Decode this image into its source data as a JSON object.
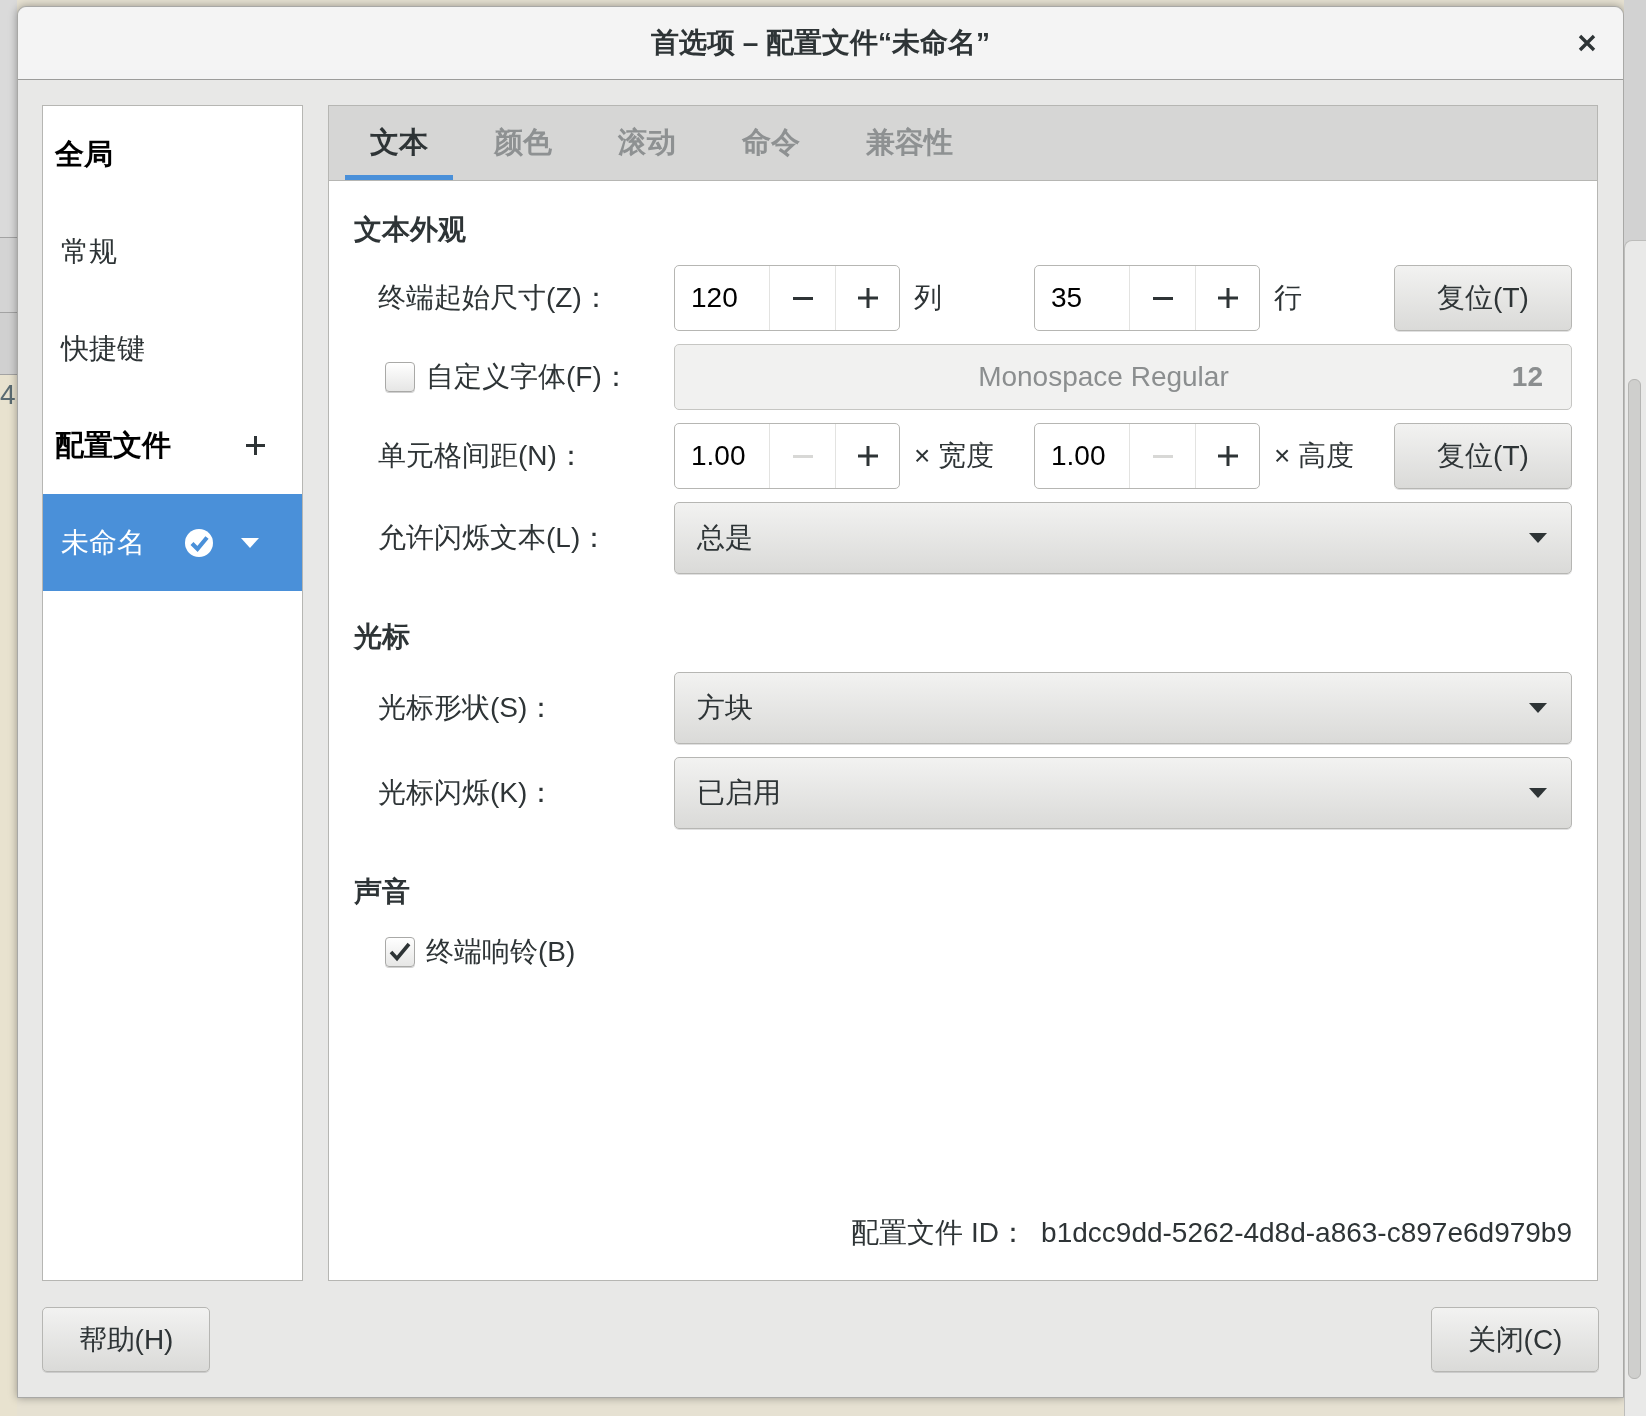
{
  "window": {
    "title": "首选项 – 配置文件“未命名”"
  },
  "background_window": {
    "text": "4"
  },
  "sidebar": {
    "groups": [
      {
        "heading": "全局",
        "items": [
          {
            "kind": "page",
            "label": "常规",
            "selected": false
          },
          {
            "kind": "page",
            "label": "快捷键",
            "selected": false
          }
        ]
      },
      {
        "heading": "配置文件",
        "add": true,
        "items": [
          {
            "kind": "profile",
            "label": "未命名",
            "default": true,
            "selected": true
          }
        ]
      }
    ]
  },
  "tabs": [
    {
      "label": "文本",
      "selected": true
    },
    {
      "label": "颜色",
      "selected": false
    },
    {
      "label": "滚动",
      "selected": false
    },
    {
      "label": "命令",
      "selected": false
    },
    {
      "label": "兼容性",
      "selected": false
    }
  ],
  "sections": [
    {
      "title": "文本外观",
      "rows": [
        {
          "kind": "spin",
          "label": "终端起始尺寸(Z)：",
          "spins": [
            {
              "value": "120",
              "minus_disabled": false,
              "unit": "列"
            },
            {
              "value": "35",
              "minus_disabled": false,
              "unit": "行"
            }
          ],
          "reset": "复位(T)"
        },
        {
          "kind": "font",
          "label": "自定义字体(F)：",
          "checked": false,
          "disabled": true,
          "font": "Monospace Regular",
          "size": "12"
        },
        {
          "kind": "spin",
          "label": "单元格间距(N)：",
          "spins": [
            {
              "value": "1.00",
              "minus_disabled": true,
              "unit": "× 宽度"
            },
            {
              "value": "1.00",
              "minus_disabled": true,
              "unit": "× 高度"
            }
          ],
          "reset": "复位(T)"
        },
        {
          "kind": "dropdown",
          "label": "允许闪烁文本(L)：",
          "value": "总是"
        }
      ]
    },
    {
      "title": "光标",
      "rows": [
        {
          "kind": "dropdown",
          "label": "光标形状(S)：",
          "value": "方块"
        },
        {
          "kind": "dropdown",
          "label": "光标闪烁(K)：",
          "value": "已启用"
        }
      ]
    },
    {
      "title": "声音",
      "rows": [
        {
          "kind": "check",
          "label": "终端响铃(B)",
          "checked": true
        }
      ]
    }
  ],
  "profile_id": {
    "label": "配置文件 ID：",
    "value": "b1dcc9dd-5262-4d8d-a863-c897e6d979b9"
  },
  "footer": {
    "help": "帮助(H)",
    "close": "关闭(C)"
  }
}
